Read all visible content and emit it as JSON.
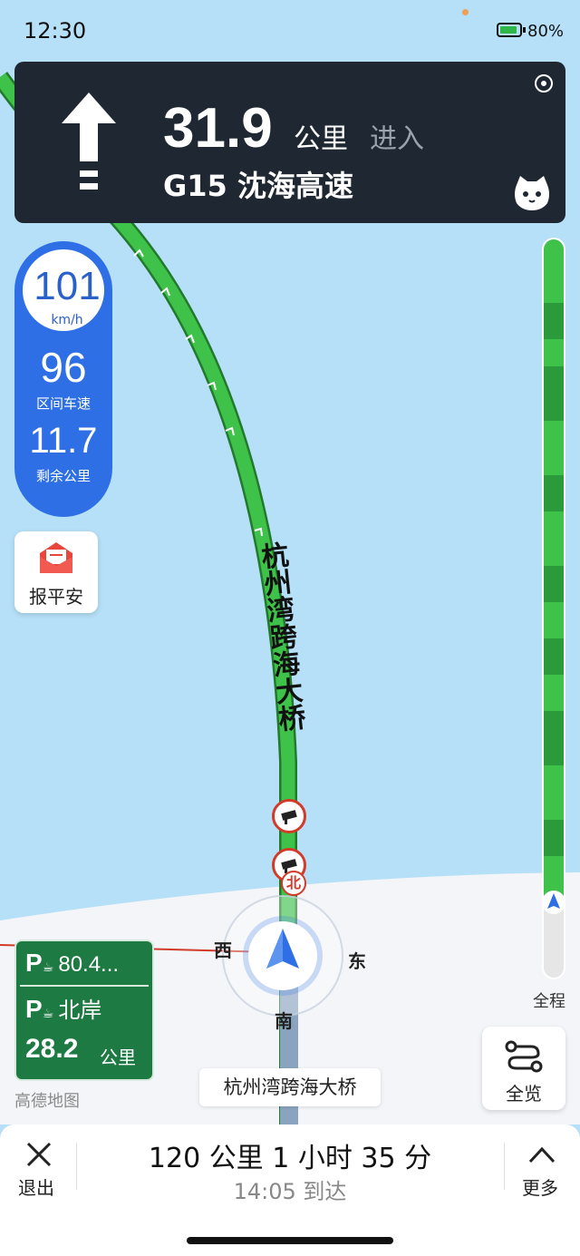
{
  "status_bar": {
    "time": "12:30",
    "battery": "80%"
  },
  "guidance": {
    "distance": "31.9",
    "unit": "公里",
    "action": "进入",
    "road": "G15 沈海高速",
    "icons": [
      "straight-arrow-icon",
      "satellite-icon",
      "mascot-icon"
    ]
  },
  "speed": {
    "current": "101",
    "current_unit": "km/h",
    "section_avg": "96",
    "section_avg_label": "区间车速",
    "remaining": "11.7",
    "remaining_label": "剩余公里"
  },
  "safe_report": {
    "label": "报平安"
  },
  "map": {
    "route_label": "杭州湾跨海大桥",
    "compass": {
      "north": "北",
      "south": "南",
      "east": "东",
      "west": "西"
    },
    "current_road": "杭州湾跨海大桥",
    "watermark": "高德地图"
  },
  "parking": {
    "first": {
      "icon": "P",
      "text": "80.4..."
    },
    "second": {
      "icon": "P",
      "text": "北岸",
      "distance": "28.2",
      "unit": "公里"
    }
  },
  "progress": {
    "label": "全程",
    "fraction_completed": 0.9
  },
  "overview_button": {
    "label": "全览"
  },
  "bottom_bar": {
    "exit_label": "退出",
    "summary": "120 公里  1 小时 35 分",
    "arrival": "14:05 到达",
    "more_label": "更多"
  },
  "colors": {
    "water": "#b6e0f8",
    "route_green": "#3ec24a",
    "speed_blue": "#2f6fe6",
    "panel_dark": "#1f2832",
    "parking_green": "#1e7a43"
  }
}
